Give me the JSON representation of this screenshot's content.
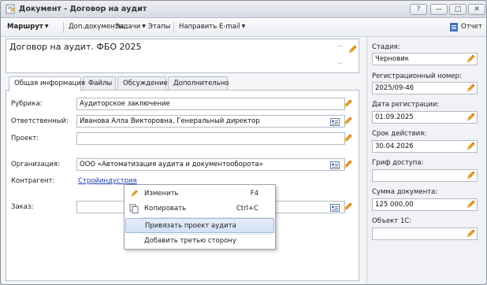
{
  "window": {
    "title": "Документ - Договор на аудит",
    "buttons": {
      "help": "?",
      "minimize": "—",
      "maximize": "□",
      "close": "✕"
    }
  },
  "toolbar": {
    "route": "Маршрут",
    "extra_docs": "Доп.документы",
    "tasks": "Задачи",
    "stages": "Этапы",
    "send_email": "Направить E-mail",
    "report": "Отчет"
  },
  "document": {
    "name": "Договор на аудит. ФБО 2025"
  },
  "tabs": [
    {
      "label": "Общая информация",
      "active": true
    },
    {
      "label": "Файлы",
      "active": false
    },
    {
      "label": "Обсуждение",
      "active": false
    },
    {
      "label": "Дополнительно",
      "active": false
    }
  ],
  "form": {
    "rubric": {
      "label": "Рубрика:",
      "value": "Аудиторское заключение"
    },
    "responsible": {
      "label": "Ответственный:",
      "value": "Иванова Алла Викторовна, Генеральный директор"
    },
    "project": {
      "label": "Проект:",
      "value": ""
    },
    "organization": {
      "label": "Организация:",
      "value": "ООО «Автоматизация аудита и документооборота»"
    },
    "counterparty": {
      "label": "Контрагент:",
      "value": "Стройиндустрия"
    },
    "order": {
      "label": "Заказ:",
      "value": ""
    }
  },
  "sidebar": {
    "stage": {
      "label": "Стадия:",
      "value": "Черновик"
    },
    "reg_number": {
      "label": "Регистрационный номер:",
      "value": "2025/09-46"
    },
    "reg_date": {
      "label": "Дата регистрации:",
      "value": "01.09.2025"
    },
    "validity": {
      "label": "Срок действия:",
      "value": "30.04.2026"
    },
    "access": {
      "label": "Гриф доступа:",
      "value": ""
    },
    "amount": {
      "label": "Сумма документа:",
      "value": "125 000,00"
    },
    "object1c": {
      "label": "Объект 1С:",
      "value": ""
    }
  },
  "context_menu": {
    "items": [
      {
        "label": "Изменить",
        "shortcut": "F4",
        "icon": "pencil-icon"
      },
      {
        "label": "Копировать",
        "shortcut": "Ctrl+C",
        "icon": "copy-icon"
      },
      {
        "label": "Привязать проект аудита",
        "shortcut": "",
        "highlighted": true
      },
      {
        "label": "Добавить третью сторону",
        "shortcut": ""
      }
    ]
  },
  "colors": {
    "accent": "#f0a31a",
    "link": "#1b3fb5",
    "highlight": "#d2e0f6"
  }
}
